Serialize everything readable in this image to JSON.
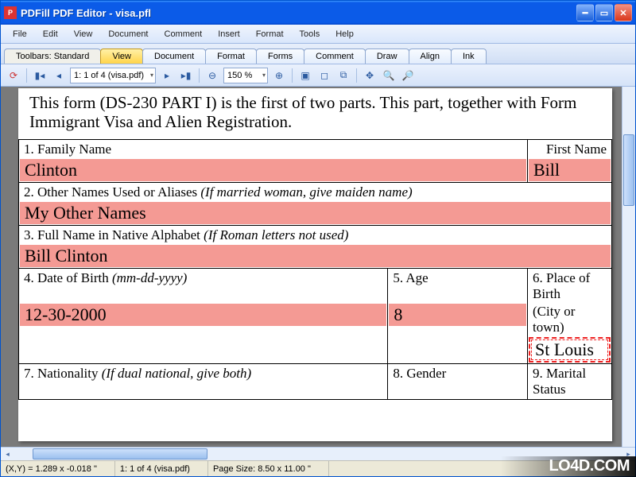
{
  "window": {
    "title": "PDFill PDF Editor - visa.pfl"
  },
  "menu": [
    "File",
    "Edit",
    "View",
    "Document",
    "Comment",
    "Insert",
    "Format",
    "Tools",
    "Help"
  ],
  "tabs": {
    "label": "Toolbars: Standard",
    "items": [
      "View",
      "Document",
      "Format",
      "Forms",
      "Comment",
      "Draw",
      "Align",
      "Ink"
    ],
    "active": 0
  },
  "toolbar": {
    "page_indicator": "1: 1 of 4 (visa.pdf)",
    "zoom": "150 %"
  },
  "document": {
    "intro": "This form (DS-230 PART I) is the first of two parts.  This part, together with Form Immigrant Visa and Alien Registration.",
    "rows": {
      "r1": {
        "family_label": "1. Family Name",
        "first_label": "First Name",
        "family_val": "Clinton",
        "first_val": "Bill"
      },
      "r2": {
        "label": "2. Other Names Used or Aliases ",
        "ital": "(If married woman, give maiden name)",
        "val": "My Other Names"
      },
      "r3": {
        "label": "3. Full Name in Native Alphabet ",
        "ital": "(If Roman letters not used)",
        "val": "Bill Clinton"
      },
      "r4": {
        "dob_label": "4. Date of Birth ",
        "dob_ital": "(mm-dd-yyyy)",
        "dob_val": "12-30-2000",
        "age_label": "5. Age",
        "age_val": "8",
        "pob_label": "6. Place of Birth",
        "pob_sub": "(City or town)",
        "pob_val": "St Louis"
      },
      "r5": {
        "nat_label": "7. Nationality ",
        "nat_ital": "(If dual national, give both)",
        "gender_label": "8. Gender",
        "marital_label": "9. Marital Status"
      }
    }
  },
  "status": {
    "coords": "(X,Y) = 1.289 x -0.018 \"",
    "page": "1: 1 of 4 (visa.pdf)",
    "size": "Page Size: 8.50 x 11.00 \""
  },
  "watermark": "LO4D.COM"
}
